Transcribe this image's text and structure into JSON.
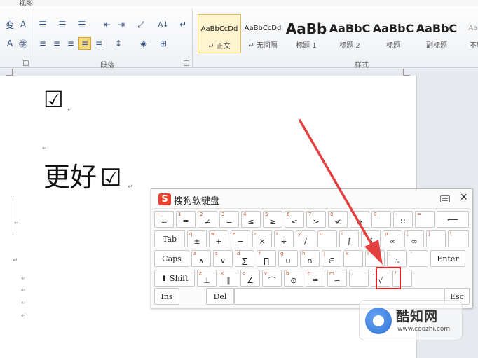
{
  "menubar": {
    "view_tab": "视图"
  },
  "ribbon": {
    "paragraph_group_label": "段落",
    "styles_group_label": "样式",
    "row1_buttons": [
      "变",
      "A",
      "☰",
      "☰",
      "☰",
      "⇤",
      "⇥",
      "⤢",
      "A↓",
      "↵"
    ],
    "row2_buttons": [
      "A",
      "㊫",
      "≡",
      "≡",
      "≡",
      "≣",
      "≣",
      "↕",
      "◈",
      "⊞"
    ],
    "styles": [
      {
        "preview": "AaBbCcDd",
        "name": "↵ 正文"
      },
      {
        "preview": "AaBbCcDd",
        "name": "↵ 无间隔"
      },
      {
        "preview": "AaBb",
        "name": "标题 1"
      },
      {
        "preview": "AaBbC",
        "name": "标题 2"
      },
      {
        "preview": "AaBbC",
        "name": "标题"
      },
      {
        "preview": "AaBbC",
        "name": "副标题"
      },
      {
        "preview": "AaBbC",
        "name": "不明显"
      }
    ]
  },
  "document": {
    "checkbox_symbol": "☑",
    "line_text": "更好",
    "para_mark": "↵"
  },
  "keyboard": {
    "title": "搜狗软键盘",
    "logo": "S",
    "close": "✕",
    "row1": [
      {
        "sh": "~",
        "mn": "≈"
      },
      {
        "sh": "1",
        "mn": "≡"
      },
      {
        "sh": "2",
        "mn": "≠"
      },
      {
        "sh": "3",
        "mn": "="
      },
      {
        "sh": "4",
        "mn": "≤"
      },
      {
        "sh": "5",
        "mn": "≥"
      },
      {
        "sh": "6",
        "mn": "<"
      },
      {
        "sh": "7",
        "mn": ">"
      },
      {
        "sh": "8",
        "mn": "≮"
      },
      {
        "sh": "9",
        "mn": "≯"
      },
      {
        "sh": "0",
        "mn": ""
      },
      {
        "sh": "-",
        "mn": "∷"
      },
      {
        "sh": "=",
        "mn": ""
      },
      {
        "sh": "",
        "mn": "⟵"
      }
    ],
    "row2": [
      {
        "sh": "",
        "mn": "Tab"
      },
      {
        "sh": "q",
        "mn": "±"
      },
      {
        "sh": "w",
        "mn": "+"
      },
      {
        "sh": "e",
        "mn": "−"
      },
      {
        "sh": "r",
        "mn": "×"
      },
      {
        "sh": "t",
        "mn": "÷"
      },
      {
        "sh": "y",
        "mn": "/"
      },
      {
        "sh": "u",
        "mn": ""
      },
      {
        "sh": "i",
        "mn": "∫"
      },
      {
        "sh": "o",
        "mn": "∮"
      },
      {
        "sh": "p",
        "mn": "∝"
      },
      {
        "sh": "[",
        "mn": "∞"
      },
      {
        "sh": "]",
        "mn": ""
      },
      {
        "sh": "\\",
        "mn": ""
      }
    ],
    "row3": [
      {
        "sh": "",
        "mn": "Caps"
      },
      {
        "sh": "a",
        "mn": "∧"
      },
      {
        "sh": "s",
        "mn": "∨"
      },
      {
        "sh": "d",
        "mn": "∑"
      },
      {
        "sh": "f",
        "mn": "∏"
      },
      {
        "sh": "g",
        "mn": "∪"
      },
      {
        "sh": "h",
        "mn": "∩"
      },
      {
        "sh": "j",
        "mn": "∈"
      },
      {
        "sh": "k",
        "mn": ""
      },
      {
        "sh": "l",
        "mn": ""
      },
      {
        "sh": ";",
        "mn": "∴"
      },
      {
        "sh": "'",
        "mn": ""
      },
      {
        "sh": "",
        "mn": "Enter"
      }
    ],
    "row4": [
      {
        "sh": "",
        "mn": "⬆ Shift"
      },
      {
        "sh": "z",
        "mn": "⊥"
      },
      {
        "sh": "x",
        "mn": "∥"
      },
      {
        "sh": "c",
        "mn": "∠"
      },
      {
        "sh": "v",
        "mn": "⌒"
      },
      {
        "sh": "b",
        "mn": "⊙"
      },
      {
        "sh": "n",
        "mn": "≌"
      },
      {
        "sh": "m",
        "mn": "∽"
      },
      {
        "sh": ",",
        "mn": ""
      },
      {
        "sh": ".",
        "mn": "√"
      },
      {
        "sh": "/",
        "mn": ""
      }
    ],
    "row5": [
      {
        "sh": "",
        "mn": "Ins"
      },
      {
        "sh": "",
        "mn": "Del"
      },
      {
        "sh": "",
        "mn": ""
      },
      {
        "sh": "",
        "mn": "Esc"
      }
    ]
  },
  "watermark": {
    "name": "酷知网",
    "url": "www.coozhi.com"
  },
  "colors": {
    "accent_red": "#e02424",
    "sogou_red": "#e9412b"
  }
}
